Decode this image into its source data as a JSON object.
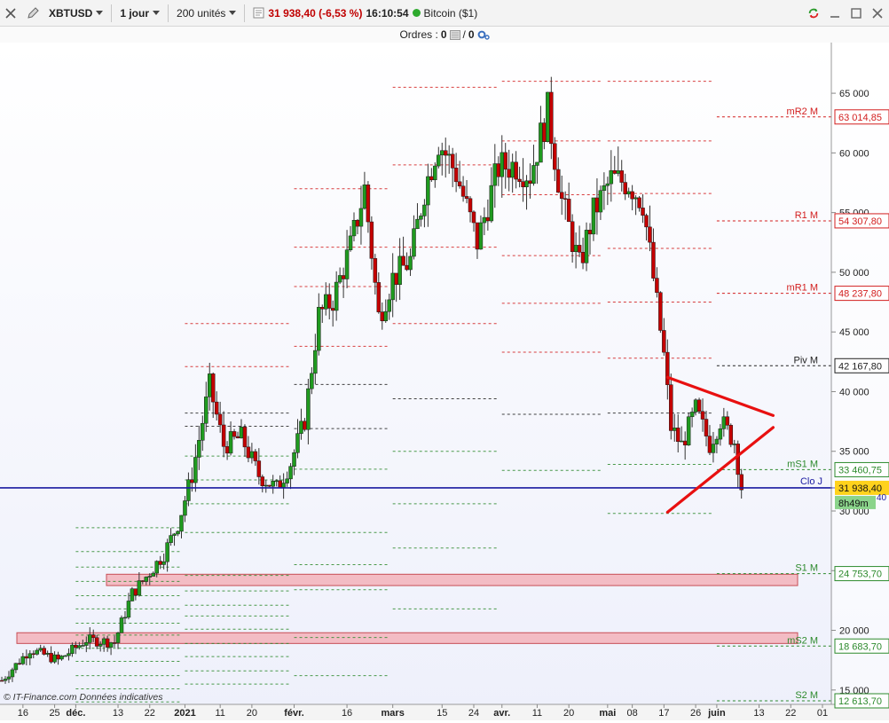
{
  "toolbar": {
    "symbol": "XBTUSD",
    "timeframe": "1 jour",
    "units": "200 unités",
    "price": "31 938,40 (-6,53 %)",
    "time": "16:10:54",
    "instrument": "Bitcoin ($1)"
  },
  "orders": {
    "label": "Ordres :",
    "count_a": "0",
    "count_b": "0"
  },
  "colors": {
    "up": "#1f9a1f",
    "down": "#c40000",
    "resistance": "#d21e1e",
    "support": "#2d8a2d",
    "pivot": "#222222",
    "close_line": "#1a1aa0",
    "zone": "#f4b3bb",
    "triangle": "#e81010"
  },
  "chart_data": {
    "type": "candlestick",
    "ylim": [
      13500,
      68500
    ],
    "y_ticks": [
      {
        "value": 15000,
        "label": "15 000"
      },
      {
        "value": 20000,
        "label": "20 000"
      },
      {
        "value": 25000,
        "label": "25 000"
      },
      {
        "value": 30000,
        "label": "30 000"
      },
      {
        "value": 35000,
        "label": "35 000"
      },
      {
        "value": 40000,
        "label": "40 000"
      },
      {
        "value": 45000,
        "label": "45 000"
      },
      {
        "value": 50000,
        "label": "50 000"
      },
      {
        "value": 55000,
        "label": "55 000"
      },
      {
        "value": 60000,
        "label": "60 000"
      },
      {
        "value": 65000,
        "label": "65 000"
      }
    ],
    "x_ticks": [
      {
        "date": "2020-11-16",
        "label": "16"
      },
      {
        "date": "2020-11-25",
        "label": "25"
      },
      {
        "date": "2020-12-01",
        "label": "déc."
      },
      {
        "date": "2020-12-13",
        "label": "13"
      },
      {
        "date": "2020-12-22",
        "label": "22"
      },
      {
        "date": "2021-01-01",
        "label": "2021"
      },
      {
        "date": "2021-01-11",
        "label": "11"
      },
      {
        "date": "2021-01-20",
        "label": "20"
      },
      {
        "date": "2021-02-01",
        "label": "févr."
      },
      {
        "date": "2021-02-16",
        "label": "16"
      },
      {
        "date": "2021-03-01",
        "label": "mars"
      },
      {
        "date": "2021-03-15",
        "label": "15"
      },
      {
        "date": "2021-03-24",
        "label": "24"
      },
      {
        "date": "2021-04-01",
        "label": "avr."
      },
      {
        "date": "2021-04-11",
        "label": "11"
      },
      {
        "date": "2021-04-20",
        "label": "20"
      },
      {
        "date": "2021-05-01",
        "label": "mai"
      },
      {
        "date": "2021-05-08",
        "label": "08"
      },
      {
        "date": "2021-05-17",
        "label": "17"
      },
      {
        "date": "2021-05-26",
        "label": "26"
      },
      {
        "date": "2021-06-01",
        "label": "juin"
      },
      {
        "date": "2021-06-13",
        "label": "13"
      },
      {
        "date": "2021-06-22",
        "label": "22"
      },
      {
        "date": "2021-07-01",
        "label": "01"
      }
    ],
    "series": [
      {
        "name": "XBTUSD",
        "dates": [
          "2020-11-10",
          "2020-11-18",
          "2020-11-26",
          "2020-12-04",
          "2020-12-12",
          "2020-12-17",
          "2020-12-20",
          "2020-12-26",
          "2020-12-30",
          "2021-01-03",
          "2021-01-08",
          "2021-01-12",
          "2021-01-17",
          "2021-01-22",
          "2021-01-27",
          "2021-01-31",
          "2021-02-04",
          "2021-02-08",
          "2021-02-12",
          "2021-02-17",
          "2021-02-21",
          "2021-02-25",
          "2021-03-01",
          "2021-03-06",
          "2021-03-10",
          "2021-03-14",
          "2021-03-19",
          "2021-03-25",
          "2021-03-31",
          "2021-04-05",
          "2021-04-09",
          "2021-04-14",
          "2021-04-18",
          "2021-04-23",
          "2021-04-27",
          "2021-05-02",
          "2021-05-07",
          "2021-05-11",
          "2021-05-14",
          "2021-05-17",
          "2021-05-19",
          "2021-05-22",
          "2021-05-26",
          "2021-05-30",
          "2021-06-02",
          "2021-06-06",
          "2021-06-08"
        ],
        "closes": [
          15800,
          18400,
          17500,
          19200,
          19000,
          23100,
          24100,
          26400,
          28900,
          33000,
          40500,
          35500,
          36200,
          33000,
          31900,
          34000,
          37600,
          46400,
          47700,
          52100,
          57000,
          46300,
          49500,
          51000,
          56900,
          61000,
          58300,
          52500,
          58800,
          59000,
          58200,
          63500,
          56000,
          50500,
          55000,
          57800,
          57500,
          55900,
          49500,
          43000,
          37000,
          35500,
          38500,
          35600,
          37600,
          35800,
          32000
        ]
      }
    ],
    "annotations": {
      "mR2": {
        "label": "mR2 M",
        "value": "63 014,85"
      },
      "R1": {
        "label": "R1 M",
        "value": "54 307,80"
      },
      "mR1": {
        "label": "mR1 M",
        "value": "48 237,80"
      },
      "Piv": {
        "label": "Piv M",
        "value": "42 167,80"
      },
      "mS1": {
        "label": "mS1 M",
        "value": "33 460,75"
      },
      "Clo": {
        "label": "Clo J",
        "value": "31 938,40"
      },
      "countdown": "8h49m",
      "S1": {
        "label": "S1 M",
        "value": "24 753,70"
      },
      "mS2": {
        "label": "mS2 M",
        "value": "18 683,70"
      },
      "S2": {
        "label": "S2 M",
        "value": "12 613,70"
      },
      "hidden_label_suffix": "40"
    },
    "watermark": "© IT-Finance.com  Données indicatives"
  }
}
